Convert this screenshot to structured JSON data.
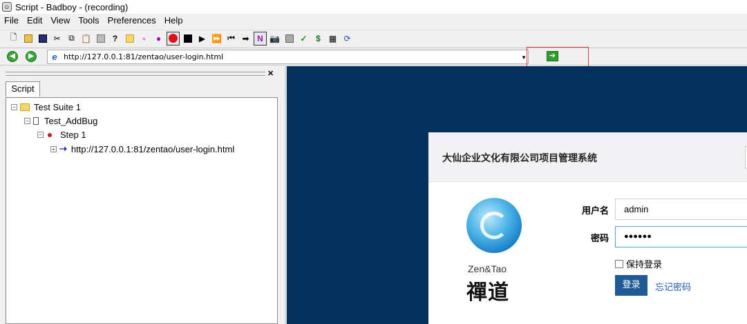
{
  "window": {
    "title": "Script - Badboy - (recording)"
  },
  "menu": [
    "File",
    "Edit",
    "View",
    "Tools",
    "Preferences",
    "Help"
  ],
  "toolbar": {
    "icons": [
      "new-document-icon",
      "open-folder-icon",
      "save-icon",
      "cut-icon",
      "copy-icon",
      "paste-icon",
      "print-icon",
      "help-icon",
      "add-suite-icon",
      "add-test-icon",
      "add-step-icon",
      "record-icon",
      "stop-icon",
      "play-icon",
      "play-all-icon",
      "rewind-icon",
      "step-forward-icon",
      "navigation-mode-icon",
      "screenshot-icon",
      "report-icon",
      "assertion-icon",
      "variable-icon",
      "spreadsheet-icon",
      "refresh-icon"
    ],
    "navigation_mode_label": "N"
  },
  "address": {
    "url": "http://127.0.0.1:81/zentao/user-login.html"
  },
  "left_pane": {
    "tab_label": "Script",
    "tree": [
      {
        "label": "Test Suite 1"
      },
      {
        "label": "Test_AddBug"
      },
      {
        "label": "Step 1"
      },
      {
        "label": "http://127.0.0.1:81/zentao/user-login.html"
      }
    ]
  },
  "login": {
    "company_title": "大仙企业文化有限公司项目管理系统",
    "logo_text": "Zen&Tao",
    "logo_cn": "禪道",
    "username_label": "用户名",
    "username_value": "admin",
    "password_label": "密码",
    "password_value": "●●●●●●",
    "remember_label": "保持登录",
    "login_button": "登录",
    "forgot_link": "忘记密码"
  },
  "colors": {
    "browser_bg": "#04325f",
    "login_button": "#1f5a96",
    "record": "#e01010",
    "highlight_box": "#d94040"
  }
}
